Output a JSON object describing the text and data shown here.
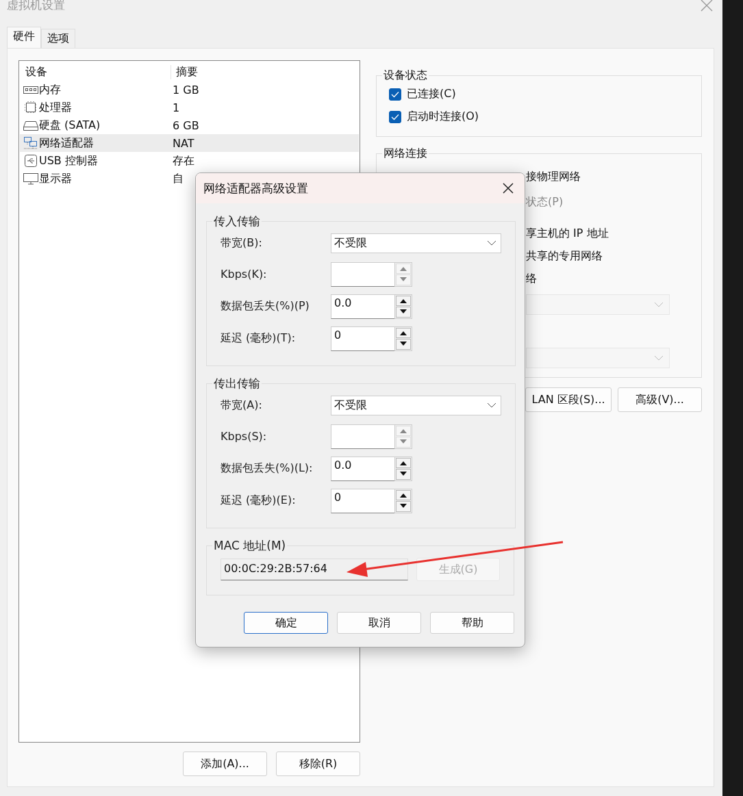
{
  "window": {
    "title": "虚拟机设置"
  },
  "tabs": [
    {
      "label": "硬件",
      "selected": true
    },
    {
      "label": "选项",
      "selected": false
    }
  ],
  "devices": {
    "columns": [
      "设备",
      "摘要"
    ],
    "rows": [
      {
        "kind": "memory",
        "name": "内存",
        "summary": "1 GB",
        "selected": false
      },
      {
        "kind": "cpu",
        "name": "处理器",
        "summary": "1",
        "selected": false
      },
      {
        "kind": "disk",
        "name": "硬盘 (SATA)",
        "summary": "6 GB",
        "selected": false
      },
      {
        "kind": "network",
        "name": "网络适配器",
        "summary": "NAT",
        "selected": true
      },
      {
        "kind": "usb",
        "name": "USB 控制器",
        "summary": "存在",
        "selected": false
      },
      {
        "kind": "display",
        "name": "显示器",
        "summary": "自",
        "selected": false
      }
    ]
  },
  "device_buttons": [
    "添加(A)...",
    "移除(R)"
  ],
  "device_status": {
    "title": "设备状态",
    "options": [
      {
        "label": "已连接(C)",
        "checked": true
      },
      {
        "label": "启动时连接(O)",
        "checked": true
      }
    ]
  },
  "network_connection": {
    "title": "网络连接",
    "fragments": [
      {
        "text": "接物理网络",
        "disabled": false
      },
      {
        "text": "状态(P)",
        "disabled": true
      },
      {
        "text": "享主机的 IP 地址",
        "disabled": false
      },
      {
        "text": "共享的专用网络",
        "disabled": false
      },
      {
        "text": "络",
        "disabled": false
      }
    ],
    "buttons": [
      "LAN 区段(S)...",
      "高级(V)..."
    ]
  },
  "dialog": {
    "title": "网络适配器高级设置",
    "groups": [
      {
        "title": "传入传输",
        "fields": [
          {
            "kind": "dropdown",
            "label": "带宽(B):",
            "value": "不受限"
          },
          {
            "kind": "spinner",
            "label": "Kbps(K):",
            "disabled": true
          },
          {
            "kind": "spinner",
            "label": "数据包丢失(%)(P)",
            "value": "0.0",
            "disabled": false
          },
          {
            "kind": "spinner",
            "label": "延迟 (毫秒)(T):",
            "value": "0",
            "disabled": false
          }
        ]
      },
      {
        "title": "传出传输",
        "fields": [
          {
            "kind": "dropdown",
            "label": "带宽(A):",
            "value": "不受限"
          },
          {
            "kind": "spinner",
            "label": "Kbps(S):",
            "disabled": true
          },
          {
            "kind": "spinner",
            "label": "数据包丢失(%)(L):",
            "value": "0.0",
            "disabled": false
          },
          {
            "kind": "spinner",
            "label": "延迟 (毫秒)(E):",
            "value": "0",
            "disabled": false
          }
        ]
      }
    ],
    "mac": {
      "title": "MAC 地址(M)",
      "value": "00:0C:29:2B:57:64",
      "button": {
        "label": "生成(G)",
        "disabled": true
      }
    },
    "buttons": [
      {
        "label": "确定",
        "default": true
      },
      {
        "label": "取消",
        "default": false
      },
      {
        "label": "帮助",
        "default": false
      }
    ]
  }
}
